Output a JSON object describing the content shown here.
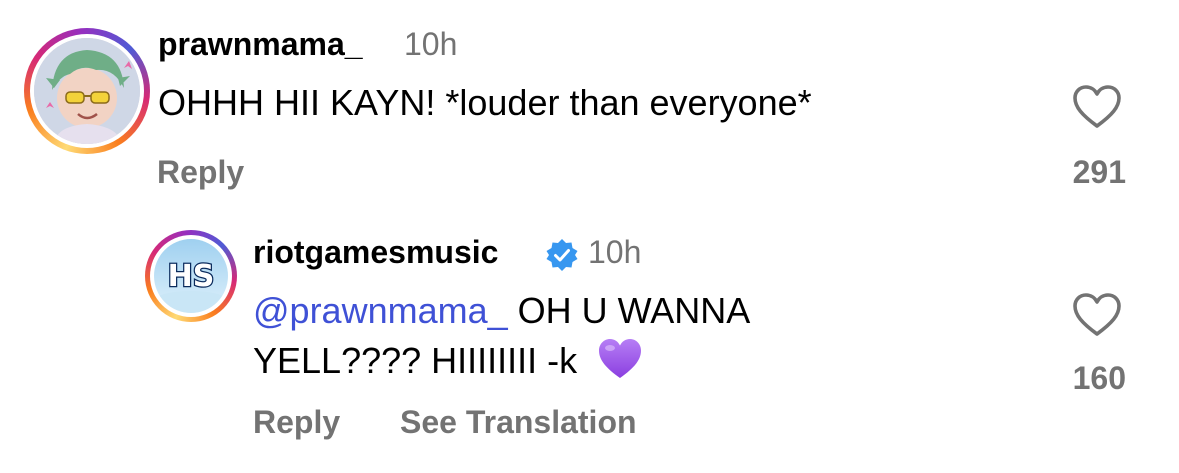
{
  "comments": [
    {
      "username": "prawnmama_",
      "time": "10h",
      "text": "OHHH HII KAYN! *louder than everyone*",
      "reply_label": "Reply",
      "likes": "291"
    }
  ],
  "reply": {
    "username": "riotgamesmusic",
    "time": "10h",
    "mention": "@prawnmama_",
    "text_line1": " OH U WANNA",
    "text_line2": "YELL???? HIIIIIIII -k",
    "emoji": "💜",
    "reply_label": "Reply",
    "translate_label": "See Translation",
    "likes": "160",
    "avatar_text": "HS"
  },
  "colors": {
    "mention": "#3f51d6",
    "muted": "#737373",
    "verified": "#3797f0"
  },
  "icons": {
    "like": "heart-outline-icon",
    "verified": "verified-badge-icon"
  }
}
